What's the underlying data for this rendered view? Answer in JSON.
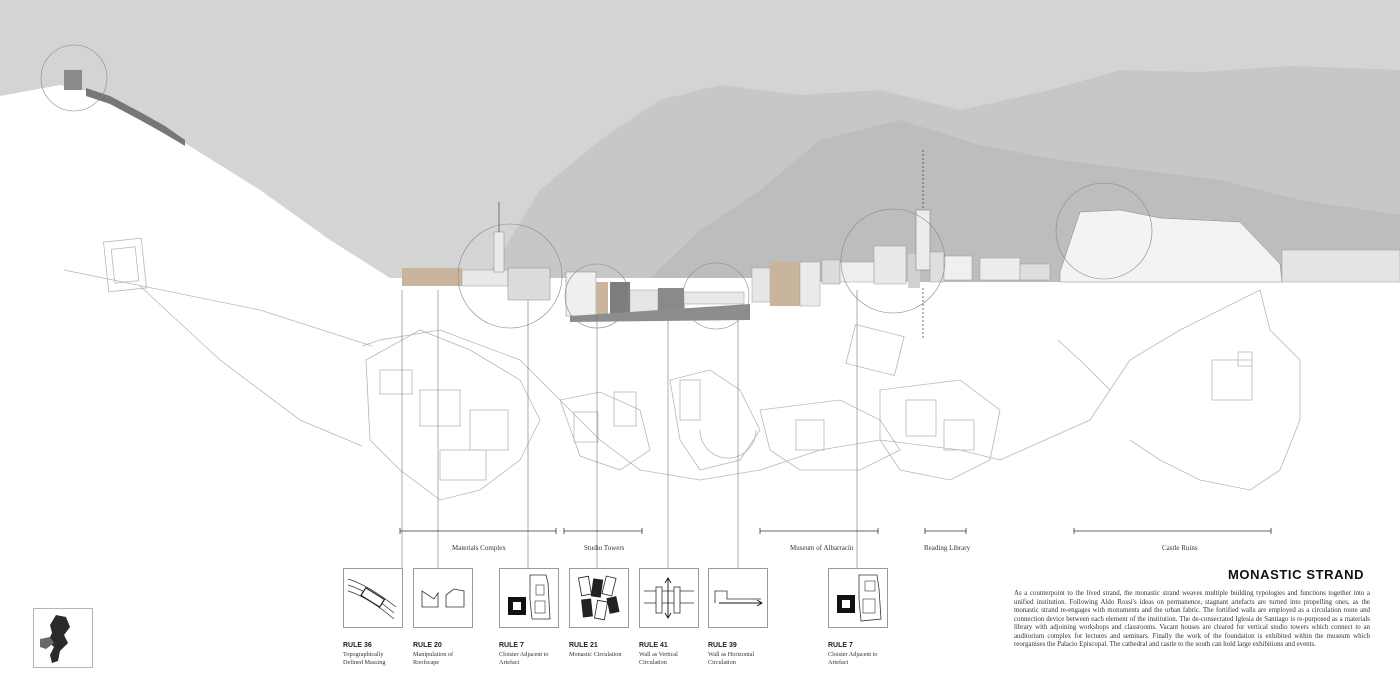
{
  "title": "MONASTIC STRAND",
  "description": "As a counterpoint to the lived strand, the monastic strand weaves multiple building typologies and functions together into a unified institution. Following Aldo Rossi's ideas on permanence, stagnant artefacts are turned into propelling ones, as the monastic strand re-engages with monuments and the urban fabric. The fortified walls are employed as a circulation route and connection device between each element of the institution. The de-consecrated Iglesia de Santiago is re-purposed as a materials library with adjoining workshops and classrooms. Vacant houses are cleared for vertical studio towers which connect to an auditorium complex for lectures and seminars. Finally the work of the foundation is exhibited within the museum which reorganises the Palacio Episcopal. The cathedral and castle to the south can hold large exhibitions and events.",
  "zones": [
    {
      "label": "Materials Complex"
    },
    {
      "label": "Studio Towers"
    },
    {
      "label": "Museum of Albarracín"
    },
    {
      "label": "Reading Library"
    },
    {
      "label": "Castle Ruins"
    }
  ],
  "rules": [
    {
      "id": "RULE 36",
      "desc": "Topographically Defined Massing",
      "icon": "topography-massing-icon"
    },
    {
      "id": "RULE 20",
      "desc": "Manipulation of Roofscape",
      "icon": "roofscape-icon"
    },
    {
      "id": "RULE 7",
      "desc": "Cloister Adjacent to Artefact",
      "icon": "cloister-artefact-icon"
    },
    {
      "id": "RULE 21",
      "desc": "Monastic Circulation",
      "icon": "monastic-circulation-icon"
    },
    {
      "id": "RULE 41",
      "desc": "Wall as Vertical Circulation",
      "icon": "vertical-circulation-icon"
    },
    {
      "id": "RULE 39",
      "desc": "Wall as Horizontal Circulation",
      "icon": "horizontal-circulation-icon"
    },
    {
      "id": "RULE 7",
      "desc": "Cloister Adjacent to Artefact",
      "icon": "cloister-artefact-icon"
    }
  ],
  "colors": {
    "sky": "#d4d4d4",
    "mountains": "#bcbcbc",
    "ink": "#222222",
    "linework": "#b8b8b8",
    "timber": "#c9b59c"
  }
}
